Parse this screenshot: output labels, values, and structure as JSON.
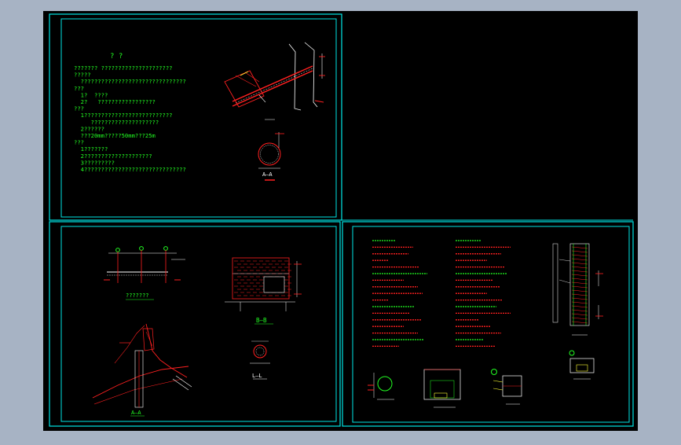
{
  "colors": {
    "frame_bg": "#a7b3c4",
    "canvas": "#000000",
    "border": "#00e5e5",
    "text": "#22ff22",
    "line": "#ff2020",
    "white": "#ffffff",
    "yellow": "#ffff33"
  },
  "notes_top_left": {
    "title": "?   ?",
    "lines": [
      "??????? ?????????????????????",
      "?????",
      "  ???????????????????????????????",
      "???",
      "  1?  ????",
      "  2?   ?????????????????",
      "???",
      "  1??????????????????????????",
      "     ????????????????????",
      "  2??????",
      "  ???20mm?????50mm???25m",
      "???",
      "  1???????",
      "  2????????????????????",
      "  3?????????",
      "  4??????????????????????????????"
    ]
  },
  "labels": {
    "section_aa": "A—A",
    "plan_caption": "???????",
    "section_bb": "B—B",
    "section_ll": "L—L",
    "section_a_lower": "A—A"
  }
}
